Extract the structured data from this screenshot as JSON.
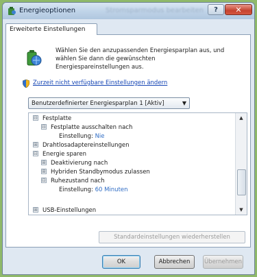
{
  "window": {
    "title": "Energieoptionen",
    "title_blurred": "Stromsparmodus bearbeiten",
    "help_label": "?",
    "close_label": "✕"
  },
  "tab": {
    "label": "Erweiterte Einstellungen"
  },
  "description": {
    "line1": "Wählen Sie den anzupassenden Energiesparplan aus, und",
    "line2": "wählen Sie dann die gewünschten",
    "line3": "Energiespareinstellungen aus."
  },
  "link": {
    "label": "Zurzeit nicht verfügbare Einstellungen ändern"
  },
  "plan_select": {
    "value": "Benutzerdefinierter Energiesparplan 1 [Aktiv]"
  },
  "tree": {
    "rows": [
      {
        "expander": "⊟",
        "label": "Festplatte"
      },
      {
        "expander": "⊟",
        "label": "Festplatte ausschalten nach"
      },
      {
        "label": "Einstellung:",
        "value": "Nie"
      },
      {
        "expander": "⊞",
        "label": "Drahtlosadaptereinstellungen"
      },
      {
        "expander": "⊟",
        "label": "Energie sparen"
      },
      {
        "expander": "⊞",
        "label": "Deaktivierung nach"
      },
      {
        "expander": "⊞",
        "label": "Hybriden Standbymodus zulassen"
      },
      {
        "expander": "⊟",
        "label": "Ruhezustand nach"
      },
      {
        "label": "Einstellung:",
        "value": "60 Minuten"
      },
      {
        "expander": "⊞",
        "label": "USB-Einstellungen"
      }
    ]
  },
  "buttons": {
    "restore": "Standardeinstellungen wiederherstellen",
    "ok": "OK",
    "cancel": "Abbrechen",
    "apply": "Übernehmen"
  },
  "icons": {
    "window": "power-options-icon",
    "plan": "battery-globe-icon",
    "shield": "uac-shield-icon"
  }
}
